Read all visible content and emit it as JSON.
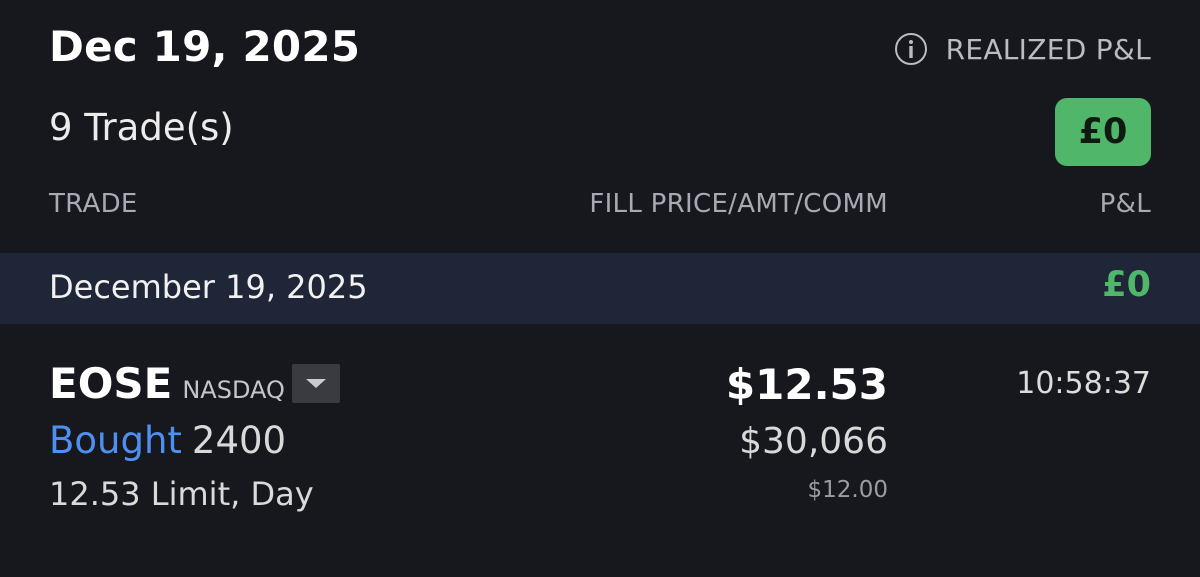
{
  "header": {
    "date_title": "Dec 19, 2025",
    "trade_count": "9 Trade(s)",
    "realized_label": "REALIZED P&L",
    "realized_value": "£0",
    "info_icon": "info-icon"
  },
  "columns": {
    "trade": "TRADE",
    "fill": "FILL PRICE/AMT/COMM",
    "pnl": "P&L"
  },
  "group": {
    "date": "December 19, 2025",
    "pnl": "£0"
  },
  "trades": [
    {
      "symbol": "EOSE",
      "exchange": "NASDAQ",
      "action": "Bought",
      "quantity": "2400",
      "order": "12.53 Limit, Day",
      "fill_price": "$12.53",
      "amount": "$30,066",
      "commission": "$12.00",
      "time": "10:58:37",
      "expand_icon": "chevron-down-icon"
    }
  ],
  "colors": {
    "background": "#17181d",
    "group_background": "#1f2638",
    "positive": "#4fb66a",
    "action_blue": "#4e8ff2"
  }
}
